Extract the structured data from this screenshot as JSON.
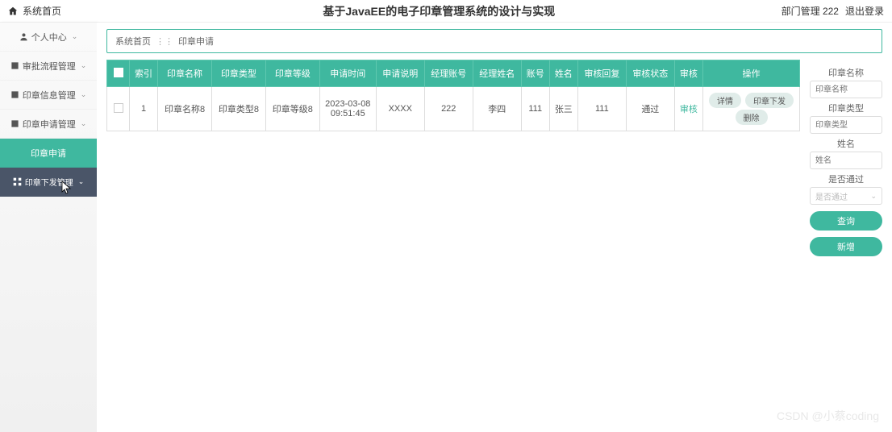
{
  "header": {
    "home_label": "系统首页",
    "title": "基于JavaEE的电子印章管理系统的设计与实现",
    "dept_label": "部门管理 222",
    "logout_label": "退出登录"
  },
  "sidebar": {
    "items": [
      {
        "label": "个人中心",
        "icon": "user-icon",
        "expandable": true
      },
      {
        "label": "审批流程管理",
        "icon": "flow-icon",
        "expandable": true
      },
      {
        "label": "印章信息管理",
        "icon": "seal-icon",
        "expandable": true
      },
      {
        "label": "印章申请管理",
        "icon": "apply-icon",
        "expandable": true
      }
    ],
    "active_sub": "印章申请",
    "bottom_sub": "印章下发管理"
  },
  "breadcrumb": {
    "root": "系统首页",
    "current": "印章申请"
  },
  "table": {
    "headers": [
      "",
      "索引",
      "印章名称",
      "印章类型",
      "印章等级",
      "申请时间",
      "申请说明",
      "经理账号",
      "经理姓名",
      "账号",
      "姓名",
      "审核回复",
      "审核状态",
      "审核",
      "操作"
    ],
    "rows": [
      {
        "index": "1",
        "seal_name": "印章名称8",
        "seal_type": "印章类型8",
        "seal_level": "印章等级8",
        "apply_time": "2023-03-08 09:51:45",
        "apply_desc": "XXXX",
        "mgr_account": "222",
        "mgr_name": "李四",
        "account": "111",
        "name": "张三",
        "audit_reply": "111",
        "audit_status": "通过",
        "audit_action": "审核",
        "ops": {
          "detail": "详情",
          "issue": "印章下发",
          "delete": "删除"
        }
      }
    ]
  },
  "filter": {
    "seal_name_label": "印章名称",
    "seal_name_placeholder": "印章名称",
    "seal_type_label": "印章类型",
    "seal_type_placeholder": "印章类型",
    "name_label": "姓名",
    "name_placeholder": "姓名",
    "pass_label": "是否通过",
    "pass_placeholder": "是否通过",
    "query_btn": "查询",
    "add_btn": "新增"
  },
  "watermark": "CSDN @小蔡coding"
}
